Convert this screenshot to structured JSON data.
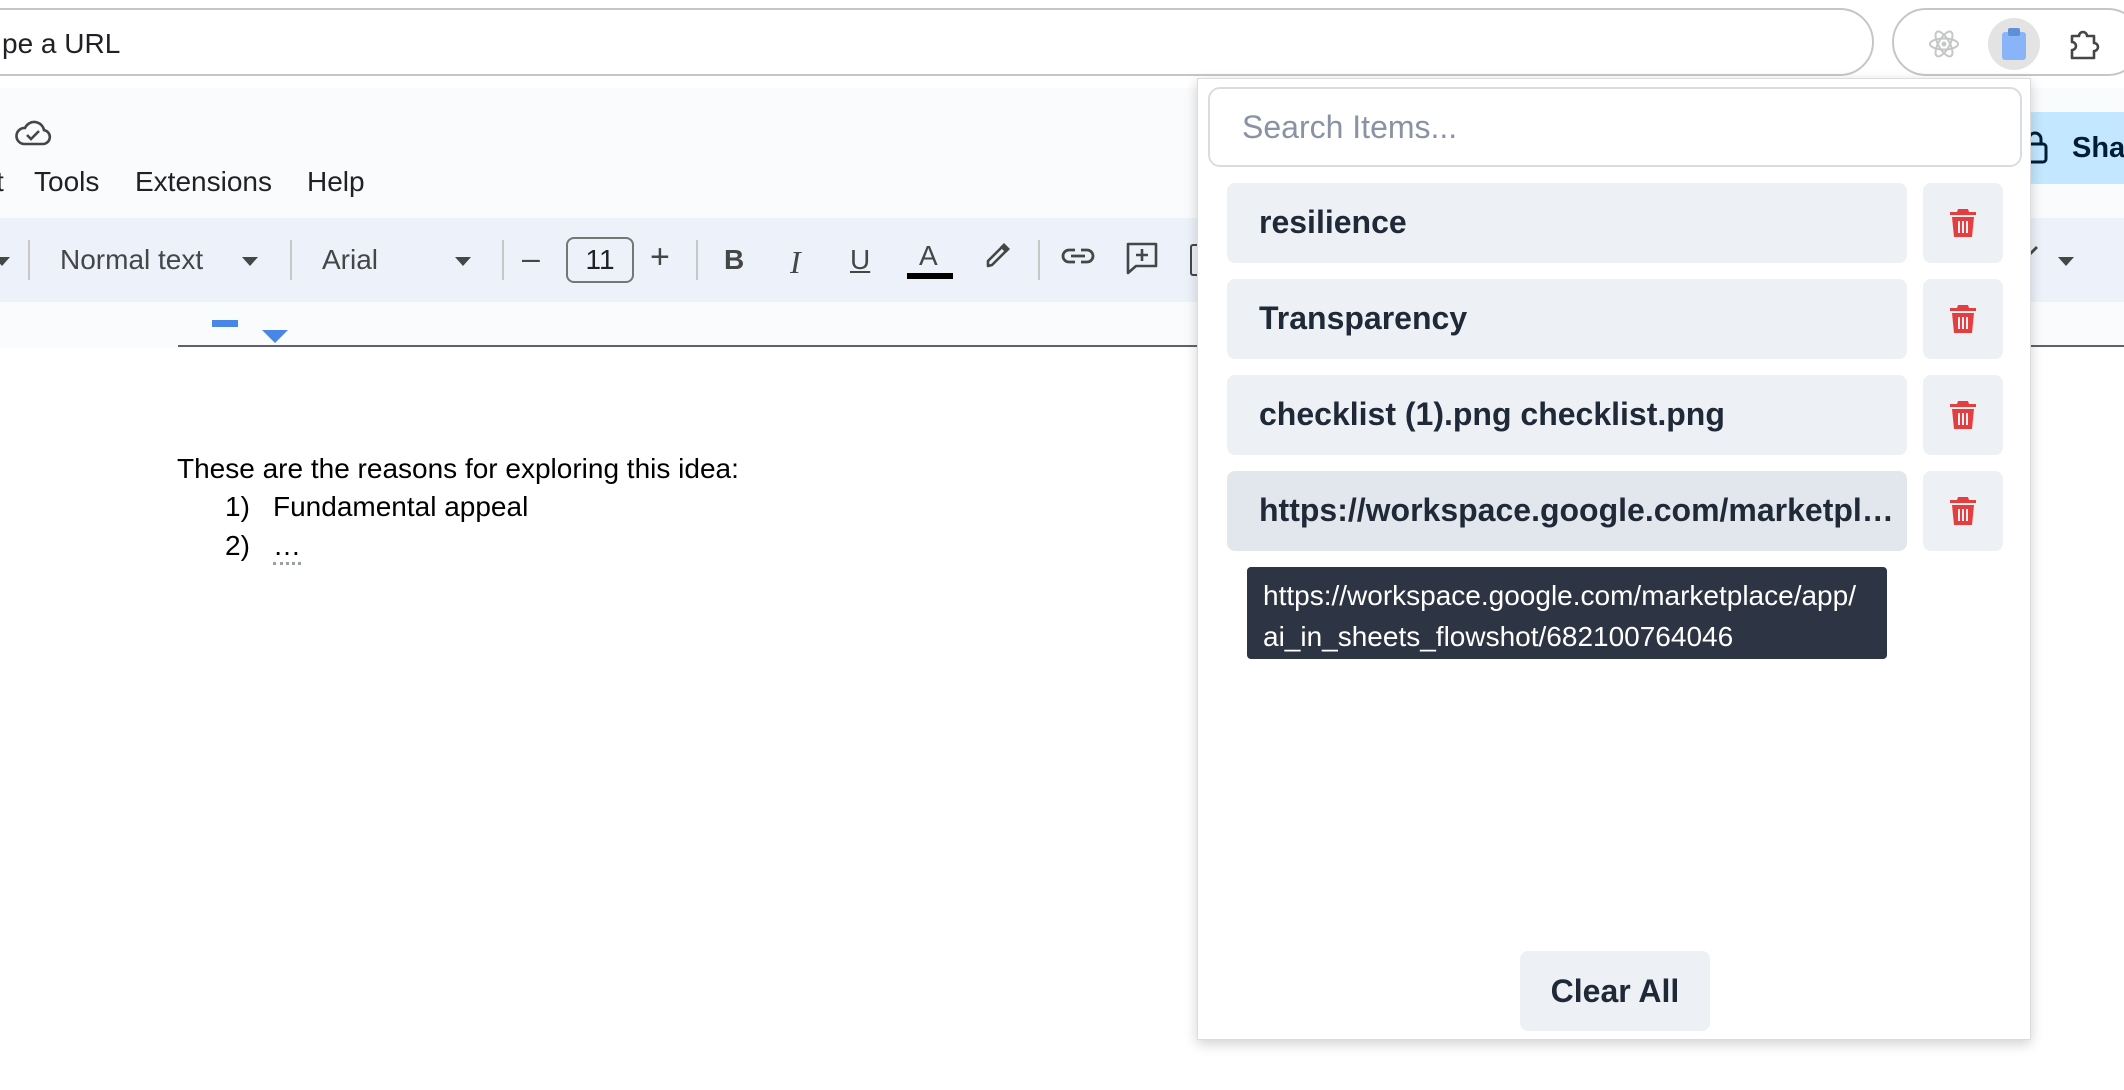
{
  "browser": {
    "omnibox_text": "pe a URL"
  },
  "docs": {
    "menu": [
      "t",
      "Tools",
      "Extensions",
      "Help"
    ],
    "toolbar": {
      "style": "Normal text",
      "font": "Arial",
      "font_size": "11",
      "minus": "–",
      "plus": "+",
      "bold": "B",
      "italic": "I",
      "underline": "U",
      "text_color": "A"
    },
    "share_label": "Shar",
    "body": {
      "intro": "These are the reasons for exploring this idea:",
      "items": [
        {
          "num": "1)",
          "text": "Fundamental appeal"
        },
        {
          "num": "2)",
          "text": "…"
        }
      ]
    }
  },
  "popup": {
    "search_placeholder": "Search Items...",
    "items": [
      {
        "text": "resilience"
      },
      {
        "text": "Transparency"
      },
      {
        "text": "checklist (1).png checklist.png"
      },
      {
        "text": "https://workspace.google.com/marketplace/app/ai_in_sheets_flowshot/682100764046"
      }
    ],
    "tooltip": "https://workspace.google.com/marketplace/app/ai_in_sheets_flowshot/682100764046",
    "clear_all": "Clear All"
  },
  "colors": {
    "delete_icon": "#e53e3e",
    "tooltip_bg": "#2d3443",
    "item_bg": "#edf0f5",
    "share_bg": "#c2e7ff",
    "accent_blue": "#4a86e8"
  }
}
